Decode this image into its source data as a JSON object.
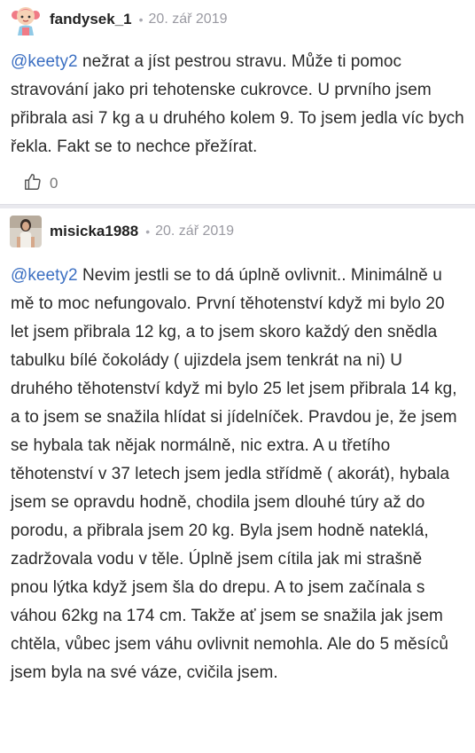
{
  "comments": [
    {
      "author": "fandysek_1",
      "date": "20. zář 2019",
      "separator": "•",
      "mention": "@keety2",
      "text": " nežrat a jíst pestrou stravu. Může ti pomoc stravování jako pri tehotenske cukrovce. U prvního jsem přibrala asi 7 kg a u druhého kolem 9. To jsem jedla víc bych řekla. Fakt se to nechce přežírat.",
      "likes": "0",
      "avatar_icon": "girl-cartoon-avatar"
    },
    {
      "author": "misicka1988",
      "date": "20. zář 2019",
      "separator": "•",
      "mention": "@keety2",
      "text": " Nevim jestli se to dá úplně ovlivnit.. Minimálně u mě to moc nefungovalo. První těhotenství když mi bylo 20 let jsem přibrala 12 kg, a to jsem skoro každý den snědla tabulku bílé čokolády ( ujizdela jsem tenkrát na ni) U druhého těhotenství když mi bylo 25 let jsem přibrala 14 kg, a to jsem se snažila hlídat si jídelníček. Pravdou je, že jsem se hybala tak nějak normálně, nic extra. A u třetího těhotenství v 37 letech jsem jedla střídmě ( akorát), hybala jsem se opravdu hodně, chodila jsem dlouhé túry až do porodu, a přibrala jsem 20 kg. Byla jsem hodně nateklá, zadržovala vodu v těle. Úplně jsem cítila jak mi strašně pnou lýtka když jsem šla do drepu. A to jsem začínala s váhou 62kg na 174 cm. Takže ať jsem se snažila jak jsem chtěla, vůbec jsem váhu ovlivnit nemohla. Ale do 5 měsíců jsem byla na své váze, cvičila jsem.",
      "avatar_icon": "photo-avatar"
    }
  ],
  "colors": {
    "mention": "#3b6fc2",
    "meta": "#9a9aa2",
    "separator_band": "#e9e9ee"
  }
}
